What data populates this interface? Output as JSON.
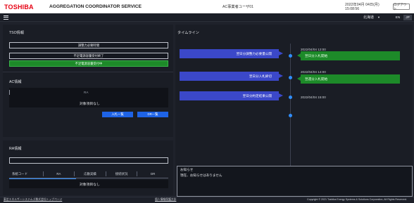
{
  "header": {
    "logo": "TOSHIBA",
    "system_title": "AGGREGATION COORDINATOR SERVICE",
    "user_name": "AC事業者ユーザ01",
    "datetime": "2022年04月 04日(月) 15:08:56",
    "logout_label": "ログアウト"
  },
  "subbar": {
    "area": "北海道",
    "lang_en": "EN",
    "lang_jp": "JP"
  },
  "tso": {
    "title": "TSO情報",
    "buttons": [
      {
        "label": "調整力必要時間"
      },
      {
        "label": "不足電源容量受付終了"
      },
      {
        "label": "不足電源容量受付中"
      }
    ]
  },
  "ac": {
    "title": "AC情報",
    "ra_label": "RA",
    "no_items": "対象項目なし",
    "bid_list": "入札一覧",
    "dr_list": "DR一覧"
  },
  "ra": {
    "title": "RA情報",
    "columns": [
      "系統コード",
      "RA",
      "応動実績",
      "接続状況",
      "DR"
    ],
    "no_items": "対象項目なし"
  },
  "timeline": {
    "title": "タイムライン",
    "events": [
      {
        "left": "翌日分調整力必要量公開",
        "date": "2022/04/04 12:00",
        "right": "翌日分入札開始"
      },
      {
        "left": "翌日分入札締切",
        "date": "2022/04/04 14:00",
        "right": "翌週分入札開始"
      },
      {
        "left": "翌日分約定結果公開",
        "date": "2022/04/04 15:00",
        "right": ""
      }
    ]
  },
  "notice": {
    "label": "お知らせ",
    "text": "現在、お知らせはありません"
  },
  "footer": {
    "link1": "東芝エネルギーシステムズ株式会社トップページ",
    "link2": "個人情報保護方針",
    "copyright": "Copyright © 2021 Toshiba Energy Systems & Solutions Corporation, All Rights Reserved."
  }
}
